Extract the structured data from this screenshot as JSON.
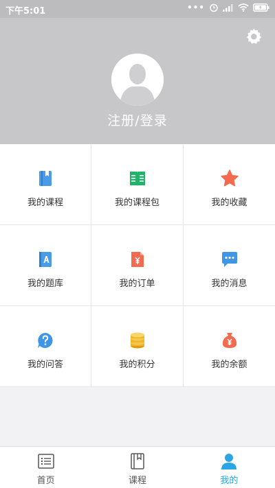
{
  "status_bar": {
    "time": "下午5:01",
    "battery": "80"
  },
  "header": {
    "login_label": "注册/登录"
  },
  "grid": [
    {
      "label": "我的课程",
      "icon": "course-book-icon",
      "color": "#4a9be8"
    },
    {
      "label": "我的课程包",
      "icon": "course-package-icon",
      "color": "#21b36b"
    },
    {
      "label": "我的收藏",
      "icon": "star-icon",
      "color": "#f26b4f"
    },
    {
      "label": "我的题库",
      "icon": "question-bank-icon",
      "color": "#4a9be8"
    },
    {
      "label": "我的订单",
      "icon": "order-icon",
      "color": "#f26b4f"
    },
    {
      "label": "我的消息",
      "icon": "message-icon",
      "color": "#3f95e6"
    },
    {
      "label": "我的问答",
      "icon": "question-icon",
      "color": "#3f95e6"
    },
    {
      "label": "我的积分",
      "icon": "coins-icon",
      "color": "#f0b62b"
    },
    {
      "label": "我的余额",
      "icon": "money-bag-icon",
      "color": "#f26b4f"
    }
  ],
  "tabs": [
    {
      "label": "首页",
      "icon": "home-list-icon",
      "active": false
    },
    {
      "label": "课程",
      "icon": "course-tab-icon",
      "active": false
    },
    {
      "label": "我的",
      "icon": "profile-icon",
      "active": true
    }
  ],
  "colors": {
    "header_bg": "#c7c7c9",
    "accent": "#2ba6e4"
  }
}
